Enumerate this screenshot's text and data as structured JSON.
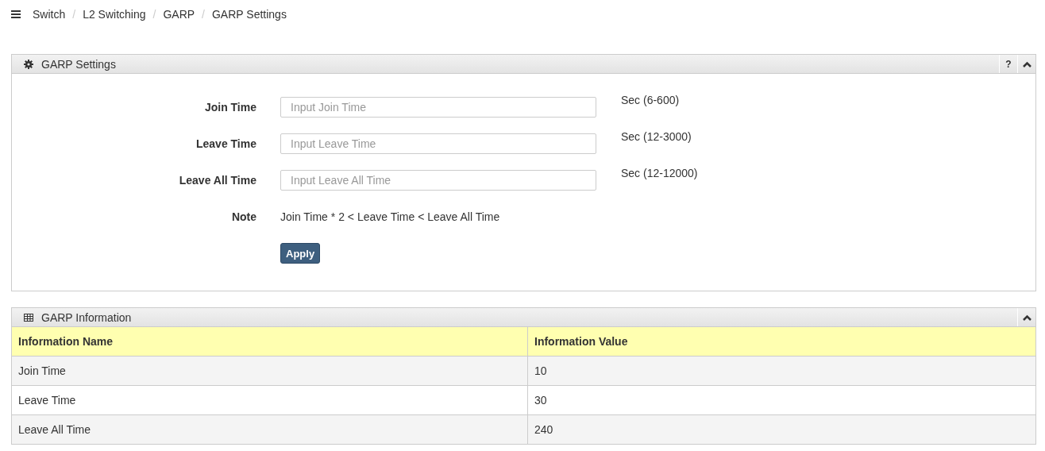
{
  "breadcrumb": {
    "separator": "/",
    "items": [
      "Switch",
      "L2 Switching",
      "GARP",
      "GARP Settings"
    ]
  },
  "settings_panel": {
    "title": "GARP Settings",
    "help": "?",
    "fields": [
      {
        "label": "Join Time",
        "placeholder": "Input Join Time",
        "hint": "Sec (6-600)"
      },
      {
        "label": "Leave Time",
        "placeholder": "Input Leave Time",
        "hint": "Sec (12-3000)"
      },
      {
        "label": "Leave All Time",
        "placeholder": "Input Leave All Time",
        "hint": "Sec (12-12000)"
      }
    ],
    "note": {
      "label": "Note",
      "text": "Join Time * 2 < Leave Time < Leave All Time"
    },
    "apply_button": "Apply"
  },
  "info_panel": {
    "title": "GARP Information",
    "columns": [
      "Information Name",
      "Information Value"
    ],
    "rows": [
      [
        "Join Time",
        "10"
      ],
      [
        "Leave Time",
        "30"
      ],
      [
        "Leave All Time",
        "240"
      ]
    ]
  }
}
